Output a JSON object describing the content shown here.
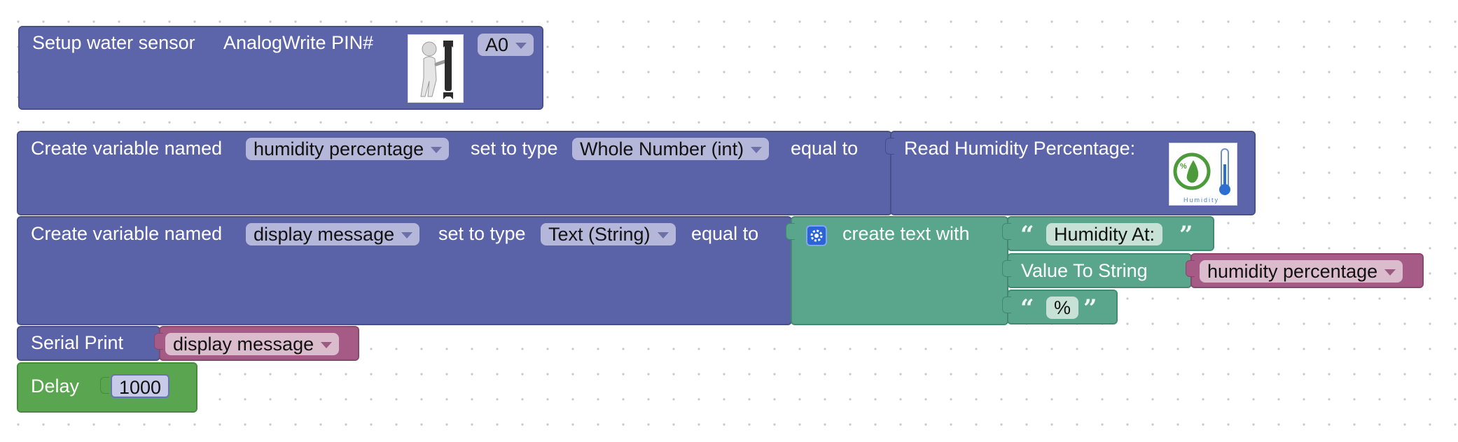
{
  "blocks": {
    "setup": {
      "label": "Setup water sensor",
      "pin_label": "AnalogWrite PIN#",
      "pin_value": "A0",
      "icon": "tools-icon"
    },
    "var1": {
      "prefix": "Create variable named",
      "name": "humidity percentage",
      "type_label": "set to type",
      "type": "Whole Number (int)",
      "equal_label": "equal to",
      "read_label": "Read Humidity Percentage:",
      "read_image_caption": "Humidity"
    },
    "var2": {
      "prefix": "Create variable named",
      "name": "display message",
      "type_label": "set to type",
      "type": "Text (String)",
      "equal_label": "equal to",
      "create_text_label": "create text with",
      "text1": "Humidity At:",
      "value_to_string_label": "Value To String",
      "value_var": "humidity percentage",
      "text2": "%"
    },
    "serial": {
      "label": "Serial Print",
      "value": "display message"
    },
    "delay": {
      "label": "Delay",
      "value": "1000"
    }
  },
  "colors": {
    "variable_block": "#5b63a8",
    "text_block": "#5aa68c",
    "variable_getter": "#a65b87",
    "delay_block": "#5aa650"
  }
}
